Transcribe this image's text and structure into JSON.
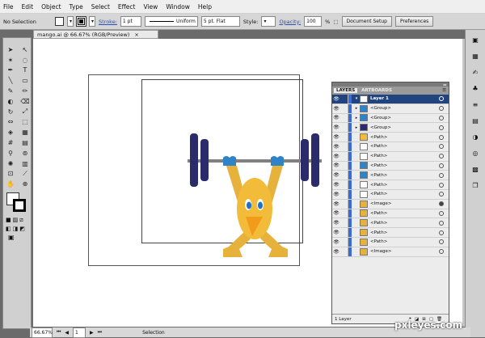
{
  "menu": [
    "File",
    "Edit",
    "Object",
    "Type",
    "Select",
    "Effect",
    "View",
    "Window",
    "Help"
  ],
  "control": {
    "selection_label": "No Selection",
    "stroke_label": "Stroke:",
    "stroke_value": "1 pt",
    "profile": "Uniform",
    "brush": "5 pt. Flat",
    "style_label": "Style:",
    "opacity_label": "Opacity:",
    "opacity_value": "100",
    "opacity_unit": "%",
    "doc_setup": "Document Setup",
    "prefs": "Preferences"
  },
  "document": {
    "tab": "mango.ai @ 66.67% (RGB/Preview)",
    "close": "×"
  },
  "layers_panel": {
    "tabs": [
      "LAYERS",
      "ARTBOARDS"
    ],
    "layer_name": "Layer 1",
    "rows": [
      "<Group>",
      "<Group>",
      "<Group>",
      "<Path>",
      "<Path>",
      "<Path>",
      "<Path>",
      "<Path>",
      "<Path>",
      "<Path>",
      "<Image>",
      "<Path>",
      "<Path>",
      "<Path>",
      "<Path>",
      "<Image>"
    ],
    "footer": "1 Layer"
  },
  "status": {
    "zoom": "66.67%",
    "page": "1",
    "tool": "Selection"
  },
  "watermark": "pxleyes.com",
  "colors": {
    "bar": "#2b2a6b",
    "body": "#f2bc3a",
    "arm": "#e7b23c",
    "beak": "#f29a1a",
    "eye": "#1e73c8",
    "bar_rod": "#808080",
    "hand": "#2f84c8"
  }
}
